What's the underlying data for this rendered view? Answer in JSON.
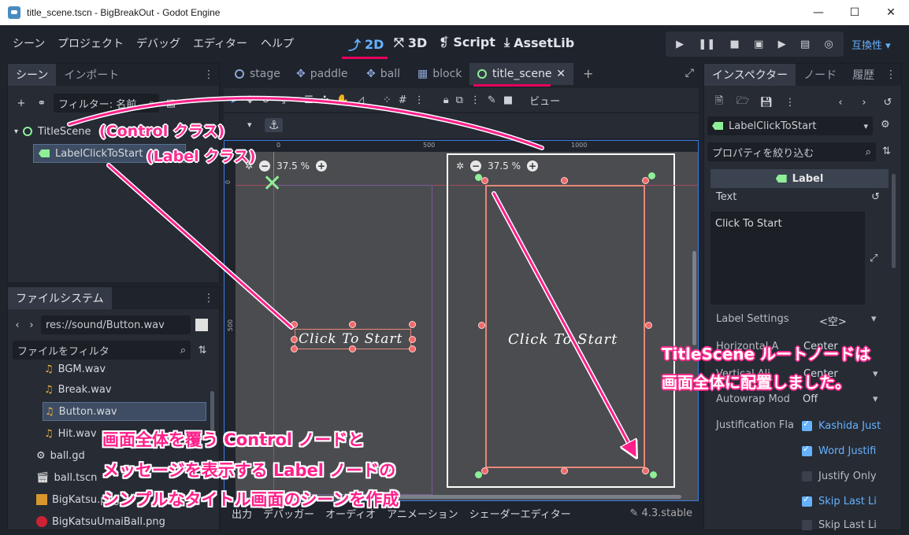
{
  "window": {
    "title": "title_scene.tscn - BigBreakOut - Godot Engine",
    "min": "—",
    "max": "☐",
    "close": "✕"
  },
  "menus": [
    "シーン",
    "プロジェクト",
    "デバッグ",
    "エディター",
    "ヘルプ"
  ],
  "workspaces": [
    "2D",
    "3D",
    "Script",
    "AssetLib"
  ],
  "renderer": "互換性",
  "scene_dock": {
    "tabs": [
      "シーン",
      "インポート"
    ],
    "filter_placeholder": "フィルター: 名前",
    "nodes": [
      "TitleScene",
      "LabelClickToStart"
    ]
  },
  "filesystem_dock": {
    "tab": "ファイルシステム",
    "path": "res://sound/Button.wav",
    "filter_placeholder": "ファイルをフィルタ",
    "files": [
      "BGM.wav",
      "Break.wav",
      "Button.wav",
      "Hit.wav",
      "ball.gd",
      "ball.tscn",
      "BigKatsu.png",
      "BigKatsuUmaiBall.png"
    ]
  },
  "editor_tabs": [
    "stage",
    "paddle",
    "ball",
    "block",
    "title_scene"
  ],
  "toolbar": {
    "view_label": "ビュー"
  },
  "viewport": {
    "ruler_labels": [
      "0",
      "500",
      "1000"
    ],
    "vruler_labels": [
      "0",
      "500"
    ],
    "zoom_left": "37.5 %",
    "zoom_right": "37.5 %",
    "label_text": "Click To Start"
  },
  "bottom_panel": {
    "tabs": [
      "出力",
      "デバッガー",
      "オーディオ",
      "アニメーション",
      "シェーダーエディター"
    ],
    "version": "4.3.stable"
  },
  "inspector": {
    "tabs": [
      "インスペクター",
      "ノード",
      "履歴"
    ],
    "node_name": "LabelClickToStart",
    "filter_placeholder": "プロパティを絞り込む",
    "class_header": "Label",
    "text_label": "Text",
    "text_value": "Click To Start",
    "label_settings": "Label Settings",
    "label_settings_value": "<空>",
    "horizontal": "Horizontal A",
    "horizontal_value": "Center",
    "vertical": "Vertical Ali",
    "vertical_value": "Center",
    "autowrap": "Autowrap Mod",
    "autowrap_value": "Off",
    "justification": "Justification Fla",
    "flags": [
      {
        "label": "Kashida Just",
        "on": true
      },
      {
        "label": "Word Justifi",
        "on": true
      },
      {
        "label": "Justify Only",
        "on": false
      },
      {
        "label": "Skip Last Li",
        "on": true
      },
      {
        "label": "Skip Last Li",
        "on": false
      }
    ]
  },
  "annotations": {
    "control": "(Control クラス)",
    "label": "(Label クラス)",
    "root_line1": "TitleScene ルートノードは",
    "root_line2": "画面全体に配置しました。",
    "summary_line1": "画面全体を覆う Control ノードと",
    "summary_line2": "メッセージを表示する Label ノードの",
    "summary_line3": "シンプルなタイトル画面のシーンを作成"
  }
}
